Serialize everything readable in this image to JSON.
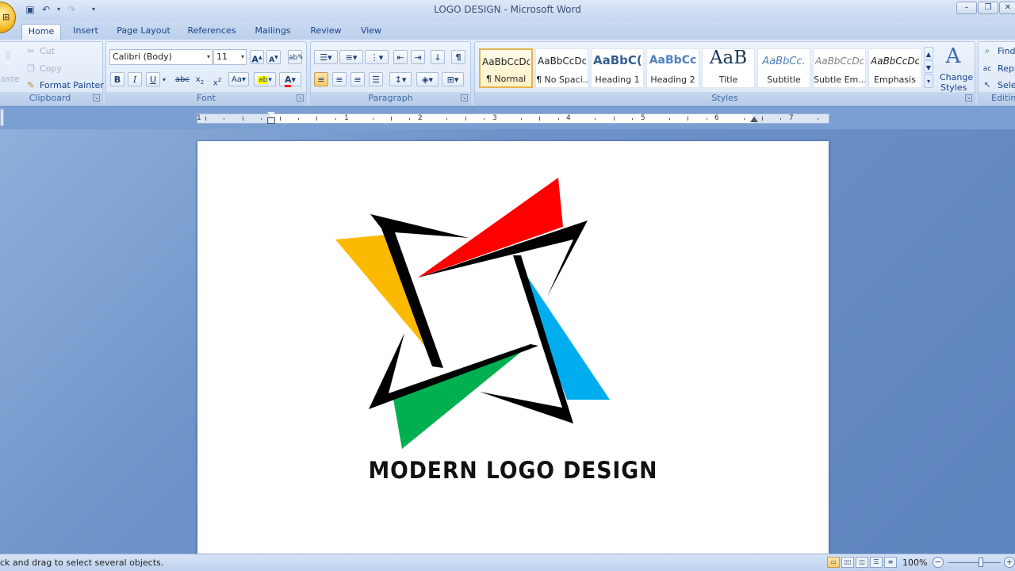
{
  "window": {
    "title": "LOGO DESIGN - Microsoft Word"
  },
  "tabs": [
    {
      "label": "Home",
      "active": true
    },
    {
      "label": "Insert"
    },
    {
      "label": "Page Layout"
    },
    {
      "label": "References"
    },
    {
      "label": "Mailings"
    },
    {
      "label": "Review"
    },
    {
      "label": "View"
    }
  ],
  "clipboard": {
    "paste_label": "aste",
    "cut_label": "Cut",
    "copy_label": "Copy",
    "format_painter_label": "Format Painter",
    "group_label": "Clipboard"
  },
  "font": {
    "name": "Calibri (Body)",
    "size": "11",
    "group_label": "Font",
    "highlight_color": "#ffff00",
    "font_color": "#ff0000"
  },
  "paragraph": {
    "group_label": "Paragraph"
  },
  "styles": {
    "group_label": "Styles",
    "change_styles_label": "Change",
    "change_styles_label2": "Styles",
    "items": [
      {
        "sample": "AaBbCcDc",
        "name": "¶ Normal",
        "selected": true
      },
      {
        "sample": "AaBbCcDc",
        "name": "¶ No Spaci..."
      },
      {
        "sample": "AaBbC(",
        "name": "Heading 1"
      },
      {
        "sample": "AaBbCc",
        "name": "Heading 2"
      },
      {
        "sample": "AaB",
        "name": "Title"
      },
      {
        "sample": "AaBbCc.",
        "name": "Subtitle"
      },
      {
        "sample": "AaBbCcDc",
        "name": "Subtle Em..."
      },
      {
        "sample": "AaBbCcDc",
        "name": "Emphasis"
      }
    ]
  },
  "editing": {
    "find_label": "Find",
    "replace_label": "Repl",
    "select_label": "Sele",
    "group_label": "Editin"
  },
  "ruler": {
    "numbers": [
      "1",
      "1",
      "2",
      "3",
      "4",
      "5",
      "6",
      "7"
    ]
  },
  "document": {
    "caption": "MODERN LOGO DESIGN",
    "colors": {
      "yellow": "#fbba00",
      "red": "#ff0000",
      "blue": "#00aeef",
      "green": "#00b050",
      "outline": "#000000"
    }
  },
  "status": {
    "text": "ck and drag to select several objects.",
    "zoom": "100%"
  }
}
